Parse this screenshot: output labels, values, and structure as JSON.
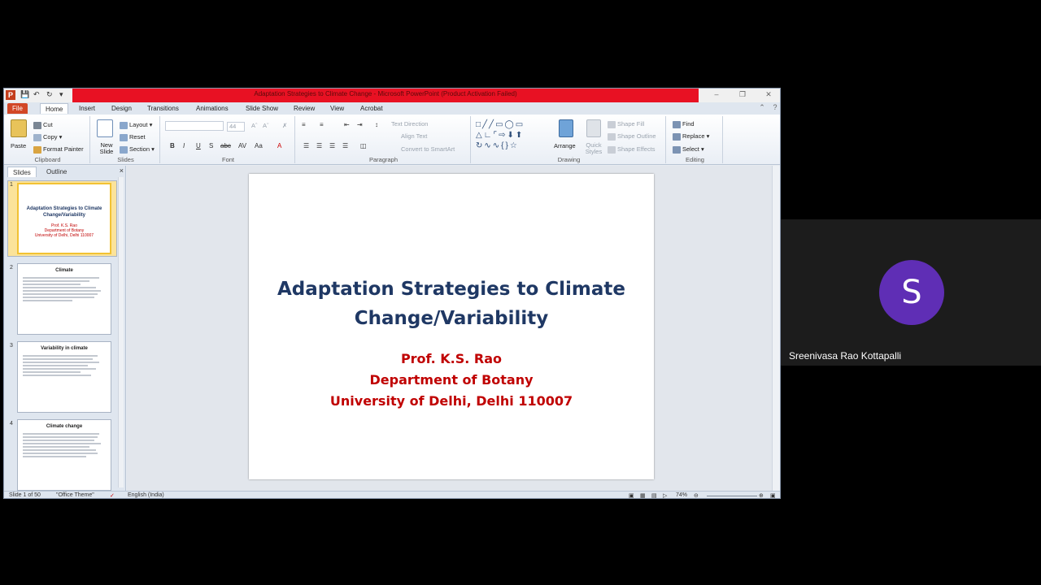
{
  "window": {
    "title": "Adaptation Strategies to Climate Change - Microsoft PowerPoint (Product Activation Failed)",
    "logo": "P"
  },
  "tabs": [
    "File",
    "Home",
    "Insert",
    "Design",
    "Transitions",
    "Animations",
    "Slide Show",
    "Review",
    "View",
    "Acrobat"
  ],
  "ribbon": {
    "clipboard": {
      "label": "Clipboard",
      "paste": "Paste",
      "cut": "Cut",
      "copy": "Copy",
      "format_painter": "Format Painter"
    },
    "slides": {
      "label": "Slides",
      "new_slide": "New Slide",
      "layout": "Layout",
      "reset": "Reset",
      "section": "Section"
    },
    "font": {
      "label": "Font",
      "size": "44"
    },
    "paragraph": {
      "label": "Paragraph",
      "text_direction": "Text Direction",
      "align_text": "Align Text",
      "convert_smartart": "Convert to SmartArt"
    },
    "drawing": {
      "label": "Drawing",
      "arrange": "Arrange",
      "quick_styles": "Quick Styles",
      "shape_fill": "Shape Fill",
      "shape_outline": "Shape Outline",
      "shape_effects": "Shape Effects"
    },
    "editing": {
      "label": "Editing",
      "find": "Find",
      "replace": "Replace",
      "select": "Select"
    }
  },
  "panel": {
    "tab_slides": "Slides",
    "tab_outline": "Outline",
    "close": "×",
    "thumbs": [
      {
        "num": "1",
        "title": "Adaptation Strategies to Climate Change/Variability",
        "lines": [
          "Prof. K.S. Rao",
          "Department of Botany",
          "University of Delhi, Delhi 110007"
        ]
      },
      {
        "num": "2",
        "title": "Climate"
      },
      {
        "num": "3",
        "title": "Variability in climate"
      },
      {
        "num": "4",
        "title": "Climate change"
      }
    ]
  },
  "slide": {
    "title_line1": "Adaptation Strategies to Climate",
    "title_line2": "Change/Variability",
    "author": "Prof. K.S. Rao",
    "department": "Department of Botany",
    "university": "University of Delhi, Delhi 110007"
  },
  "status": {
    "slide_info": "Slide 1 of 50",
    "theme": "\"Office Theme\"",
    "language": "English (India)",
    "zoom": "74%"
  },
  "participant": {
    "initial": "S",
    "name": "Sreenivasa Rao Kottapalli",
    "avatar_color": "#5f2eb5"
  }
}
